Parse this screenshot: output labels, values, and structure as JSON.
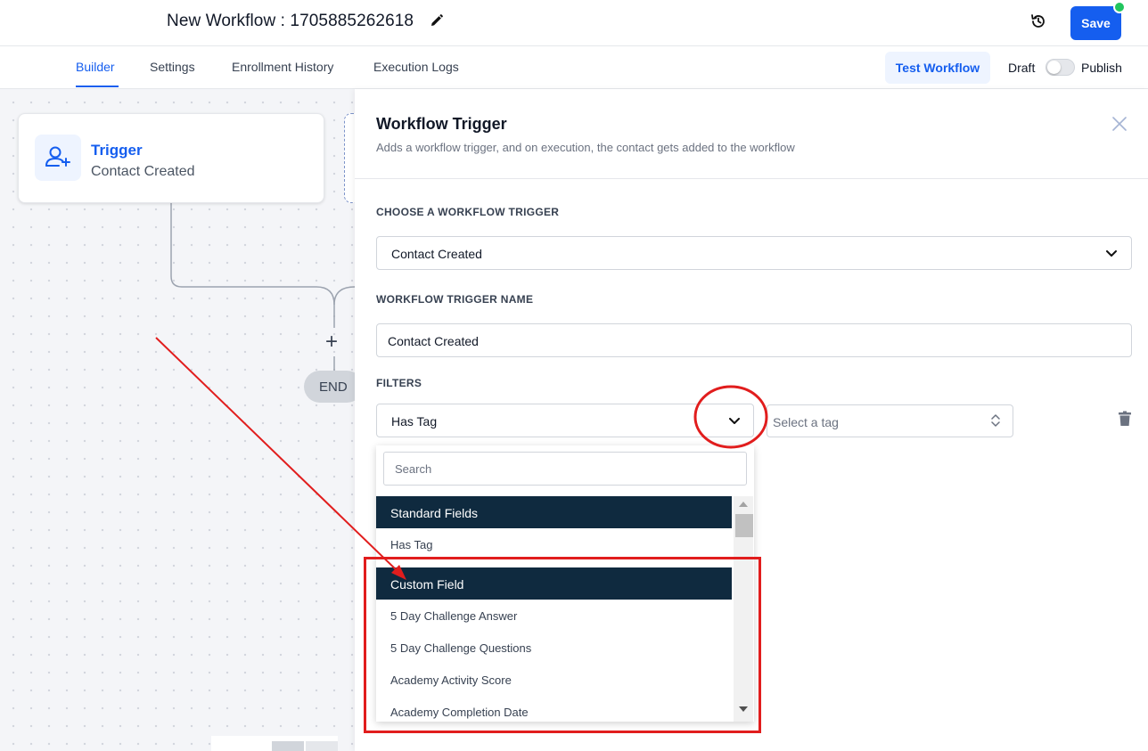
{
  "header": {
    "workflow_title": "New Workflow : 1705885262618",
    "save_label": "Save"
  },
  "tabs": [
    {
      "label": "Builder",
      "active": true
    },
    {
      "label": "Settings"
    },
    {
      "label": "Enrollment History"
    },
    {
      "label": "Execution Logs"
    }
  ],
  "actions": {
    "test_workflow": "Test Workflow",
    "draft": "Draft",
    "publish": "Publish"
  },
  "canvas": {
    "trigger_title": "Trigger",
    "trigger_subtitle": "Contact Created",
    "add_symbol": "+",
    "end_label": "END"
  },
  "panel": {
    "title": "Workflow Trigger",
    "description": "Adds a workflow trigger, and on execution, the contact gets added to the workflow",
    "choose_label": "CHOOSE A WORKFLOW TRIGGER",
    "trigger_value": "Contact Created",
    "name_label": "WORKFLOW TRIGGER NAME",
    "name_value": "Contact Created",
    "filters_label": "FILTERS",
    "filter_value": "Has Tag",
    "tag_placeholder": "Select a tag"
  },
  "dropdown": {
    "search_placeholder": "Search",
    "groups": [
      {
        "header": "Standard Fields",
        "items": [
          "Has Tag"
        ]
      },
      {
        "header": "Custom Field",
        "items": [
          "5 Day Challenge Answer",
          "5 Day Challenge Questions",
          "Academy Activity Score",
          "Academy Completion Date"
        ]
      }
    ]
  },
  "colors": {
    "accent": "#155eef",
    "dropdown_header": "#0f2a3f",
    "annotation": "#e11d1d",
    "online_dot": "#22c55e"
  }
}
